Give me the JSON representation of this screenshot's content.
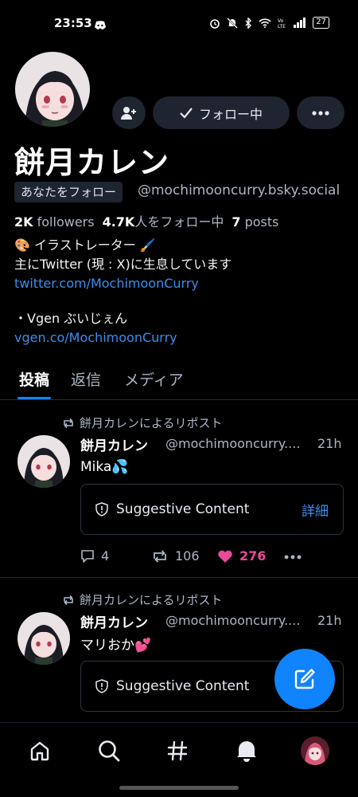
{
  "status_bar": {
    "time": "23:53",
    "battery": "27"
  },
  "profile": {
    "display_name": "餅月カレン",
    "follows_you_badge": "あなたをフォロー",
    "handle": "@mochimooncurry.bsky.social",
    "following_button_label": "フォロー中",
    "stats": {
      "followers_count": "2K",
      "followers_label": "followers",
      "following_count": "4.7K",
      "following_label": "人をフォロー中",
      "posts_count": "7",
      "posts_label": "posts"
    },
    "bio": {
      "line1": "🎨 イラストレーター 🖌️",
      "line2": "主にTwitter (現 : X)に生息しています",
      "link1": "twitter.com/MochimoonCurry",
      "line3": "・Vgen ぶいじぇん",
      "link2": "vgen.co/MochimoonCurry"
    }
  },
  "tabs": [
    {
      "label": "投稿",
      "active": true
    },
    {
      "label": "返信",
      "active": false
    },
    {
      "label": "メディア",
      "active": false
    }
  ],
  "posts": [
    {
      "repost_label": "餅月カレンによるリポスト",
      "author": "餅月カレン",
      "handle": "@mochimooncurry....",
      "time": "21h",
      "text": "Mika💦",
      "warning_label": "Suggestive Content",
      "warning_action": "詳細",
      "replies": "4",
      "reposts": "106",
      "likes": "276"
    },
    {
      "repost_label": "餅月カレンによるリポスト",
      "author": "餅月カレン",
      "handle": "@mochimooncurry....",
      "time": "21h",
      "text": "マリおか💕",
      "warning_label": "Suggestive Content"
    }
  ],
  "colors": {
    "accent": "#1083fe",
    "like": "#ec4899",
    "link": "#3b8ef0",
    "background": "#000000"
  },
  "nav": [
    "home-icon",
    "search-icon",
    "hashtag-icon",
    "notifications-icon",
    "profile-avatar"
  ]
}
